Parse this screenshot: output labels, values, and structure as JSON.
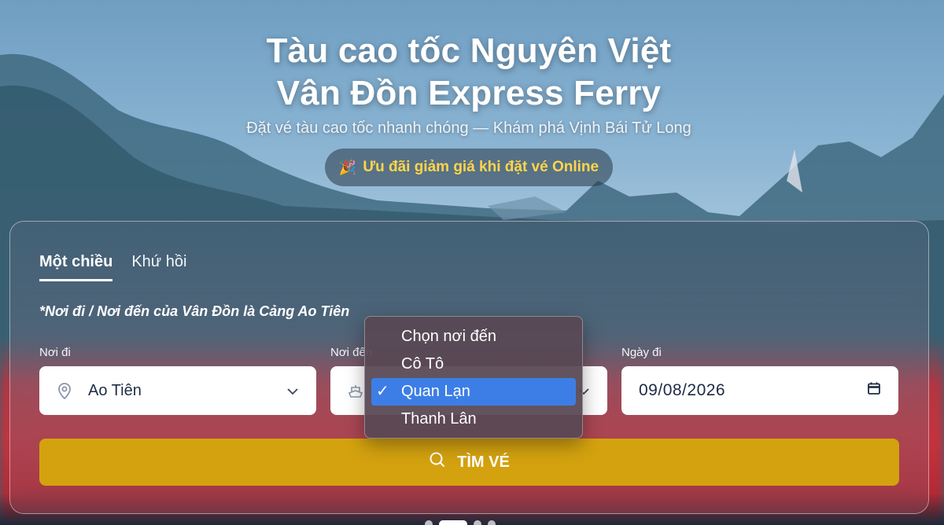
{
  "hero": {
    "title_line1": "Tàu cao tốc Nguyên Việt",
    "title_line2": "Vân Đồn Express Ferry",
    "subtitle": "Đặt vé tàu cao tốc nhanh chóng — Khám phá Vịnh Bái Tử Long",
    "promo_icon": "party-popper-icon",
    "promo_text": "Ưu đãi giảm giá khi đặt vé Online"
  },
  "tabs": [
    {
      "label": "Một chiều",
      "active": true
    },
    {
      "label": "Khứ hồi",
      "active": false
    }
  ],
  "note": "*Nơi đi / Nơi đến của Vân Đồn là Cảng Ao Tiên",
  "fields": {
    "from": {
      "label": "Nơi đi",
      "value": "Ao Tiên",
      "icon": "location-pin-icon"
    },
    "to": {
      "label": "Nơi đến",
      "icon": "ship-icon"
    },
    "date": {
      "label": "Ngày đi",
      "value": "09/08/2026",
      "icon": "calendar-icon"
    }
  },
  "search_button": {
    "label": "TÌM VÉ",
    "icon": "search-icon"
  },
  "dropdown": {
    "options": [
      "Chọn nơi đến",
      "Cô Tô",
      "Quan Lạn",
      "Thanh Lân"
    ],
    "selected": "Quan Lạn",
    "highlight_color": "#3d7ee6"
  },
  "colors": {
    "accent_button": "#d4a20f",
    "promo_text": "#ffd54a"
  }
}
